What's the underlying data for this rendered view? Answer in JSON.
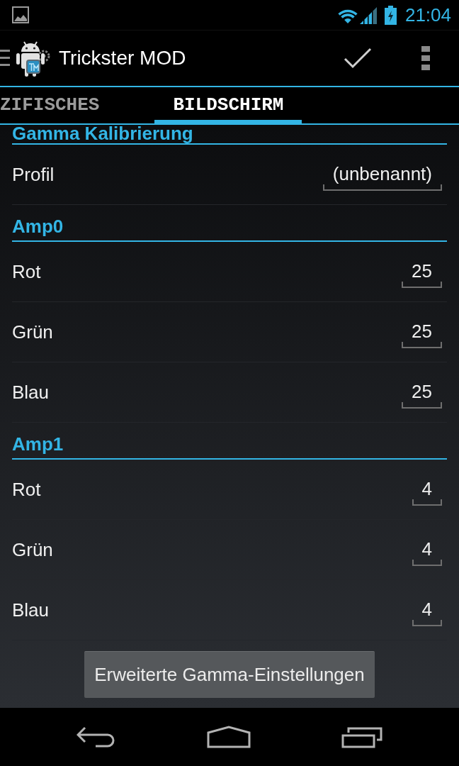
{
  "status_bar": {
    "time": "21:04"
  },
  "action_bar": {
    "title": "Trickster MOD"
  },
  "tabs": [
    {
      "label": "ZIFISCHES",
      "selected": false
    },
    {
      "label": "BILDSCHIRM",
      "selected": true
    }
  ],
  "sections": [
    {
      "title": "Gamma Kalibrierung",
      "rows": [
        {
          "label": "Profil",
          "value": "(unbenannt)"
        }
      ]
    },
    {
      "title": "Amp0",
      "rows": [
        {
          "label": "Rot",
          "value": "25"
        },
        {
          "label": "Grün",
          "value": "25"
        },
        {
          "label": "Blau",
          "value": "25"
        }
      ]
    },
    {
      "title": "Amp1",
      "rows": [
        {
          "label": "Rot",
          "value": "4"
        },
        {
          "label": "Grün",
          "value": "4"
        },
        {
          "label": "Blau",
          "value": "4"
        }
      ]
    }
  ],
  "button": {
    "label": "Erweiterte Gamma-Einstellungen"
  }
}
